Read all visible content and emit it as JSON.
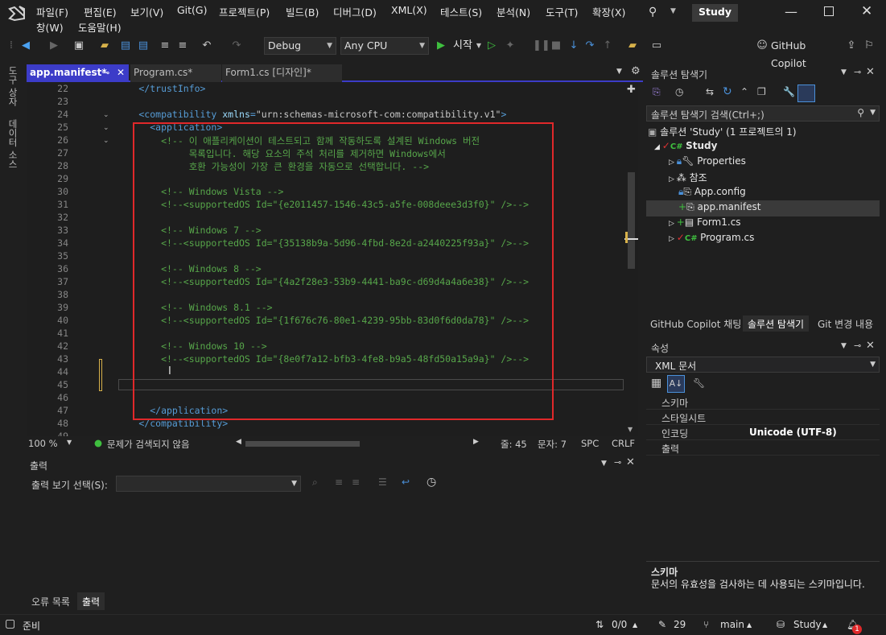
{
  "app": {
    "solution_badge": "Study"
  },
  "menu": [
    "파일(F)",
    "편집(E)",
    "보기(V)",
    "Git(G)",
    "프로젝트(P)",
    "빌드(B)",
    "디버그(D)",
    "XML(X)",
    "테스트(S)",
    "분석(N)",
    "도구(T)",
    "확장(X)",
    "창(W)",
    "도움말(H)"
  ],
  "toolbar": {
    "config": "Debug",
    "platform": "Any CPU",
    "start_label": "시작",
    "copilot_label": "GitHub Copilot"
  },
  "left_strip": {
    "toolbox": "도구 상자",
    "datasource": "데이터 소스"
  },
  "tabs": [
    {
      "label": "app.manifest*",
      "active": true
    },
    {
      "label": "Program.cs*",
      "active": false
    },
    {
      "label": "Form1.cs [디자인]*",
      "active": false
    }
  ],
  "code_lines": [
    {
      "n": "22",
      "parts": [
        [
          "tag",
          "        </trustInfo>"
        ]
      ]
    },
    {
      "n": "23",
      "parts": []
    },
    {
      "n": "24",
      "parts": [
        [
          "tag",
          "        <compatibility "
        ],
        [
          "attr",
          "xmlns"
        ],
        [
          "tag",
          "="
        ],
        [
          "str",
          "\"urn:schemas-microsoft-com:compatibility.v1\""
        ],
        [
          "tag",
          ">"
        ]
      ]
    },
    {
      "n": "25",
      "parts": [
        [
          "tag",
          "          <application>"
        ]
      ]
    },
    {
      "n": "26",
      "parts": [
        [
          "com",
          "            <!-- 이 애플리케이션이 테스트되고 함께 작동하도록 설계된 Windows 버전"
        ]
      ]
    },
    {
      "n": "27",
      "parts": [
        [
          "com",
          "                 목록입니다. 해당 요소의 주석 처리를 제거하면 Windows에서"
        ]
      ]
    },
    {
      "n": "28",
      "parts": [
        [
          "com",
          "                 호환 가능성이 가장 큰 환경을 자동으로 선택합니다. -->"
        ]
      ]
    },
    {
      "n": "29",
      "parts": []
    },
    {
      "n": "30",
      "parts": [
        [
          "com",
          "            <!-- Windows Vista -->"
        ]
      ]
    },
    {
      "n": "31",
      "parts": [
        [
          "com",
          "            <!--<supportedOS Id=\"{e2011457-1546-43c5-a5fe-008deee3d3f0}\" />-->"
        ]
      ]
    },
    {
      "n": "32",
      "parts": []
    },
    {
      "n": "33",
      "parts": [
        [
          "com",
          "            <!-- Windows 7 -->"
        ]
      ]
    },
    {
      "n": "34",
      "parts": [
        [
          "com",
          "            <!--<supportedOS Id=\"{35138b9a-5d96-4fbd-8e2d-a2440225f93a}\" />-->"
        ]
      ]
    },
    {
      "n": "35",
      "parts": []
    },
    {
      "n": "36",
      "parts": [
        [
          "com",
          "            <!-- Windows 8 -->"
        ]
      ]
    },
    {
      "n": "37",
      "parts": [
        [
          "com",
          "            <!--<supportedOS Id=\"{4a2f28e3-53b9-4441-ba9c-d69d4a4a6e38}\" />-->"
        ]
      ]
    },
    {
      "n": "38",
      "parts": []
    },
    {
      "n": "39",
      "parts": [
        [
          "com",
          "            <!-- Windows 8.1 -->"
        ]
      ]
    },
    {
      "n": "40",
      "parts": [
        [
          "com",
          "            <!--<supportedOS Id=\"{1f676c76-80e1-4239-95bb-83d0f6d0da78}\" />-->"
        ]
      ]
    },
    {
      "n": "41",
      "parts": []
    },
    {
      "n": "42",
      "parts": [
        [
          "com",
          "            <!-- Windows 10 -->"
        ]
      ]
    },
    {
      "n": "43",
      "parts": [
        [
          "com",
          "            <!--<supportedOS Id=\"{8e0f7a12-bfb3-4fe8-b9a5-48fd50a15a9a}\" />-->"
        ]
      ]
    },
    {
      "n": "44",
      "parts": []
    },
    {
      "n": "45",
      "parts": []
    },
    {
      "n": "46",
      "parts": []
    },
    {
      "n": "47",
      "parts": [
        [
          "tag",
          "          </application>"
        ]
      ]
    },
    {
      "n": "48",
      "parts": [
        [
          "tag",
          "        </compatibility>"
        ]
      ]
    },
    {
      "n": "49",
      "parts": []
    }
  ],
  "editor_status": {
    "zoom": "100 %",
    "issues": "문제가 검색되지 않음",
    "line": "줄: 45",
    "col": "문자: 7",
    "spc": "SPC",
    "crlf": "CRLF"
  },
  "output": {
    "title": "출력",
    "show_label": "출력 보기 선택(S):"
  },
  "bottom_tabs": [
    "오류 목록",
    "출력"
  ],
  "solution_explorer": {
    "title": "솔루션 탐색기",
    "search_placeholder": "솔루션 탐색기 검색(Ctrl+;)",
    "solution": "솔루션 'Study' (1 프로젝트의 1)",
    "project": "Study",
    "items": [
      "Properties",
      "참조",
      "App.config",
      "app.manifest",
      "Form1.cs",
      "Program.cs"
    ]
  },
  "right_tabs": [
    "GitHub Copilot 채팅",
    "솔루션 탐색기",
    "Git 변경 내용"
  ],
  "properties": {
    "title": "속성",
    "object": "XML 문서",
    "rows": [
      {
        "name": "스키마",
        "value": ""
      },
      {
        "name": "스타일시트",
        "value": ""
      },
      {
        "name": "인코딩",
        "value": "Unicode (UTF-8)"
      },
      {
        "name": "출력",
        "value": ""
      }
    ],
    "desc_title": "스키마",
    "desc_text": "문서의 유효성을 검사하는 데 사용되는 스키마입니다."
  },
  "status": {
    "ready": "준비",
    "changes": "0/0",
    "edits": "29",
    "branch": "main",
    "repo": "Study",
    "notifications": "1"
  }
}
